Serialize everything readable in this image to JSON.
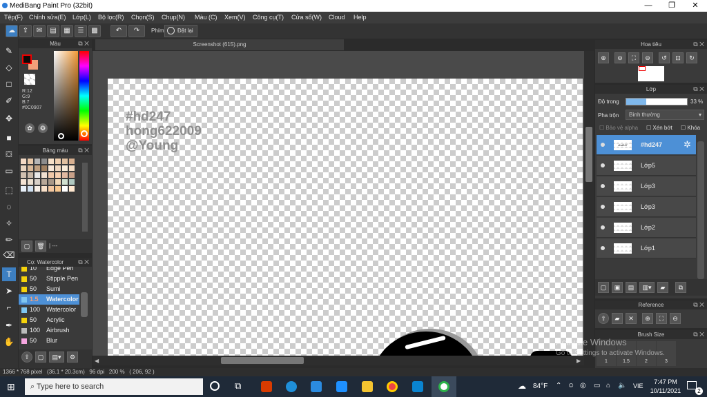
{
  "window": {
    "title": "MediBang Paint Pro (32bit)",
    "minimize": "—",
    "maximize": "❐",
    "close": "✕"
  },
  "menu": [
    "Tệp(F)",
    "Chỉnh sửa(E)",
    "Lớp(L)",
    "Bộ lọc(R)",
    "Chọn(S)",
    "Chụp(N)",
    "Màu (C)",
    "Xem(V)",
    "Công cụ(T)",
    "Cửa sổ(W)",
    "Cloud",
    "Help"
  ],
  "toolbar": {
    "phim_label": "Phím",
    "reset_label": "Đặt lại"
  },
  "color_panel": {
    "title": "Màu",
    "r": "R:12",
    "g": "G:9",
    "b": "B:7",
    "hex": "#0C0907",
    "foreground": "#0c0907",
    "background": "#f4a07a"
  },
  "palette_panel": {
    "title": "Bảng màu",
    "footer": "| ---"
  },
  "brush_panel": {
    "title": "Cọ: Watercolor",
    "items": [
      {
        "size": "10",
        "name": "Edge Pen",
        "color": "#f5d20a"
      },
      {
        "size": "50",
        "name": "Stipple Pen",
        "color": "#f5d20a"
      },
      {
        "size": "50",
        "name": "Sumi",
        "color": "#f5d20a"
      },
      {
        "size": "1.5",
        "name": "Watercolor",
        "color": "#7fc6f0"
      },
      {
        "size": "100",
        "name": "Watercolor",
        "color": "#7fc6f0"
      },
      {
        "size": "50",
        "name": "Acrylic",
        "color": "#f5d20a"
      },
      {
        "size": "100",
        "name": "Airbrush",
        "color": "#bbbbbb"
      },
      {
        "size": "50",
        "name": "Blur",
        "color": "#f6a6e0"
      }
    ]
  },
  "document_tab": "Screenshot (615).png",
  "watermark": [
    "#hd247",
    "hong622009",
    "@Young"
  ],
  "navigator": {
    "title": "Hoa tiêu"
  },
  "layer_panel": {
    "title": "Lớp",
    "opacity_label": "Độ trong",
    "opacity_value": "33 %",
    "opacity_fraction": 0.33,
    "blend_label": "Pha trộn",
    "blend_value": "Bình thường",
    "protect_alpha": "Bảo vệ alpha",
    "clipping": "Xén bớt",
    "lock": "Khóa",
    "layers": [
      "#hd247",
      "Lớp5",
      "Lớp3",
      "Lớp3",
      "Lớp2",
      "Lớp1"
    ]
  },
  "reference_panel": {
    "title": "Reference"
  },
  "brush_size_panel": {
    "title": "Brush Size",
    "sizes": [
      "1",
      "1.5",
      "2",
      "3"
    ]
  },
  "activate": {
    "line1": "Activate Windows",
    "line2": "Go to Settings to activate Windows."
  },
  "status_bar": {
    "text": "1366 * 768 pixel   (36.1 * 20.3cm)   96 dpi   200 %   ( 206, 92 )"
  },
  "taskbar": {
    "search_placeholder": "Type here to search",
    "weather": "84°F",
    "language": "VIE",
    "time": "7:47 PM",
    "date": "10/11/2021",
    "notifications": "2"
  }
}
